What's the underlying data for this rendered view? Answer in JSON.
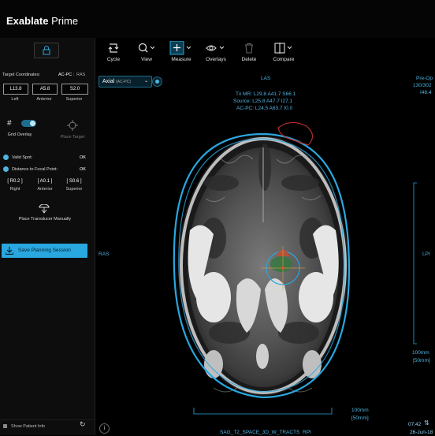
{
  "app": {
    "brand_bold": "Exablate",
    "brand_rest": " Prime"
  },
  "toolbar": {
    "cycle": "Cycle",
    "view": "View",
    "measure": "Measure",
    "overlays": "Overlays",
    "delete": "Delete",
    "compare": "Compare"
  },
  "sidebar": {
    "target_coords_label": "Target Coordinates:",
    "coord_system_active": "AC-PC",
    "coord_system_other": "RAS",
    "coords": [
      {
        "value": "L13.8",
        "label": "Left"
      },
      {
        "value": "A5.8",
        "label": "Anterior"
      },
      {
        "value": "S2.0",
        "label": "Superior"
      }
    ],
    "grid_overlay": "Grid Overlay",
    "place_target": "Place Target",
    "valid_spot": "Valid Spot:",
    "valid_spot_status": "OK",
    "distance_focal": "Distance to Focal Point:",
    "distance_status": "OK",
    "offsets": [
      {
        "value": "[ R0.2 ]",
        "label": "Right"
      },
      {
        "value": "[ A0.1 ]",
        "label": "Anterior"
      },
      {
        "value": "[ S0.6 ]",
        "label": "Superior"
      }
    ],
    "place_transducer": "Place Transducer Manually",
    "save_session": "Save Planning Session",
    "show_patient_info": "Show Patient Info"
  },
  "viewer": {
    "view_mode": "Axial",
    "view_mode_sub": "(AC-PC)",
    "top_orientation": "LAS",
    "left_orientation": "RAS",
    "right_orientation": "LPI",
    "bottom_orientation": "RPI",
    "tx_line": "Tx MR: L29.8 A41.7 S66.1",
    "source_line": "Source: L25.8 A47.7 I27.1",
    "acpc_line": "AC-PC: L24.5 A63.7 I0.0",
    "preop_1": "Pre-Op",
    "preop_2": "130/302",
    "preop_3": "I48.4",
    "scale_v_1": "100mm",
    "scale_v_2": "[50mm]",
    "scale_h_1": "100mm",
    "scale_h_2": "[50mm]",
    "series": "SAG_T2_SPACE_3D_W_TRACTS",
    "time": "07:42",
    "date": "26-Jun-18",
    "info_icon": "i"
  }
}
